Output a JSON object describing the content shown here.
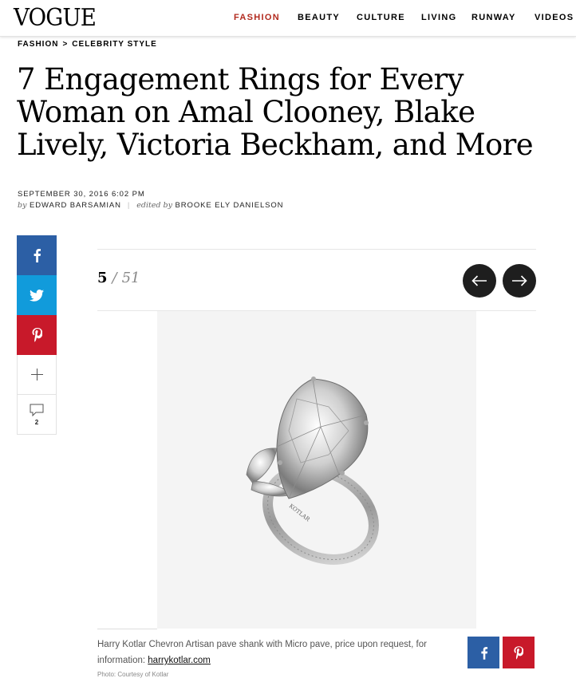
{
  "header": {
    "logo": "VOGUE",
    "nav": [
      {
        "label": "FASHION",
        "active": true
      },
      {
        "label": "BEAUTY",
        "active": false
      },
      {
        "label": "CULTURE",
        "active": false
      },
      {
        "label": "LIVING",
        "active": false
      },
      {
        "label": "RUNWAY",
        "active": false
      },
      {
        "label": "VIDEOS",
        "active": false
      }
    ],
    "accent_color": "#b22a1e"
  },
  "breadcrumb": {
    "section": "FASHION",
    "separator": ">",
    "subsection": "CELEBRITY STYLE"
  },
  "article": {
    "title": "7 Engagement Rings for Every Woman on Amal Clooney, Blake Lively, Victoria Beckham, and More",
    "date": "SEPTEMBER 30, 2016 6:02 PM",
    "by_label": "by",
    "author": "EDWARD BARSAMIAN",
    "pipe": "|",
    "edited_label": "edited by",
    "editor": "BROOKE ELY DANIELSON"
  },
  "share": {
    "facebook_icon": "facebook-icon",
    "twitter_icon": "twitter-icon",
    "pinterest_icon": "pinterest-icon",
    "more_icon": "plus-icon",
    "comment_icon": "comment-icon",
    "comment_count": "2",
    "colors": {
      "facebook": "#2c5fa5",
      "twitter": "#119bdb",
      "pinterest": "#c8192a"
    }
  },
  "slideshow": {
    "current": "5",
    "slash": "/",
    "total": "51",
    "prev_icon": "arrow-left-icon",
    "next_icon": "arrow-right-icon",
    "caption_text": "Harry Kotlar Chevron Artisan pave shank with Micro pave, price upon request, for information: ",
    "caption_link": "harrykotlar.com",
    "credit": "Photo: Courtesy of Kotlar",
    "ring_engraving": "KOTLAR"
  }
}
